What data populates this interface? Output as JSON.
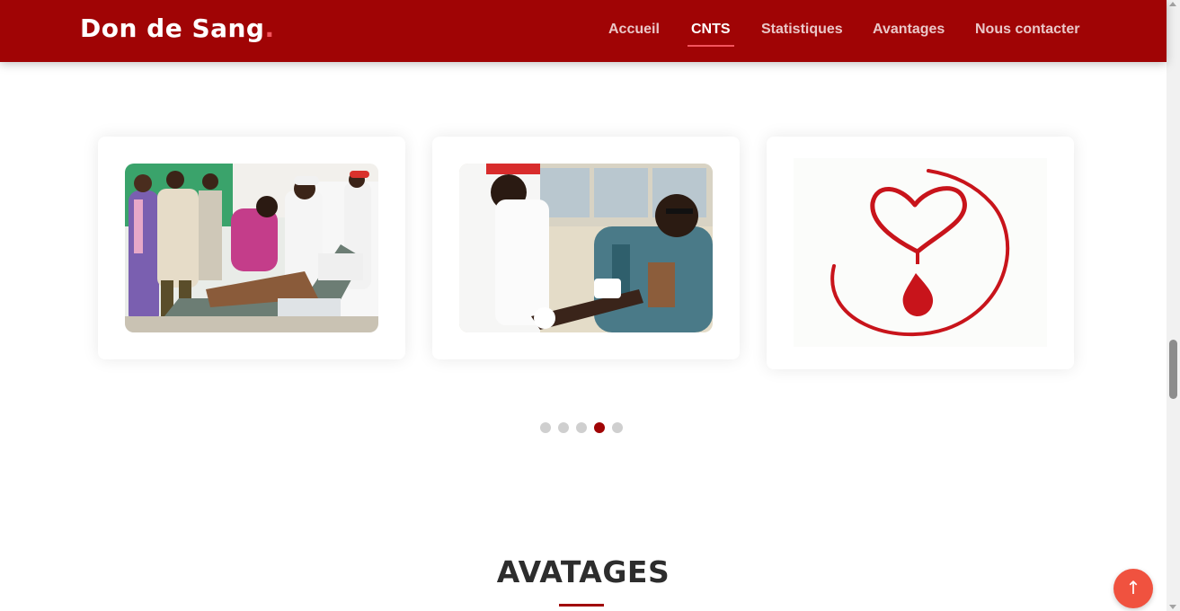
{
  "header": {
    "logo_text": "Don de Sang",
    "logo_dot": "."
  },
  "nav": {
    "items": [
      {
        "label": "Accueil",
        "active": false
      },
      {
        "label": "CNTS",
        "active": true
      },
      {
        "label": "Statistiques",
        "active": false
      },
      {
        "label": "Avantages",
        "active": false
      },
      {
        "label": "Nous contacter",
        "active": false
      }
    ]
  },
  "carousel": {
    "slides": [
      {
        "type": "photo",
        "subject": "blood donation event group photo"
      },
      {
        "type": "photo",
        "subject": "donor giving blood"
      },
      {
        "type": "logo",
        "subject": "heart and blood drop logo"
      }
    ],
    "dot_count": 5,
    "active_dot": 4
  },
  "section": {
    "title": "AVATAGES"
  },
  "back_to_top": {
    "icon": "arrow-up-icon",
    "glyph": "↑"
  },
  "colors": {
    "brand_red": "#a00405",
    "accent_coral": "#f3545d",
    "back_top_bg": "#f0523f"
  }
}
